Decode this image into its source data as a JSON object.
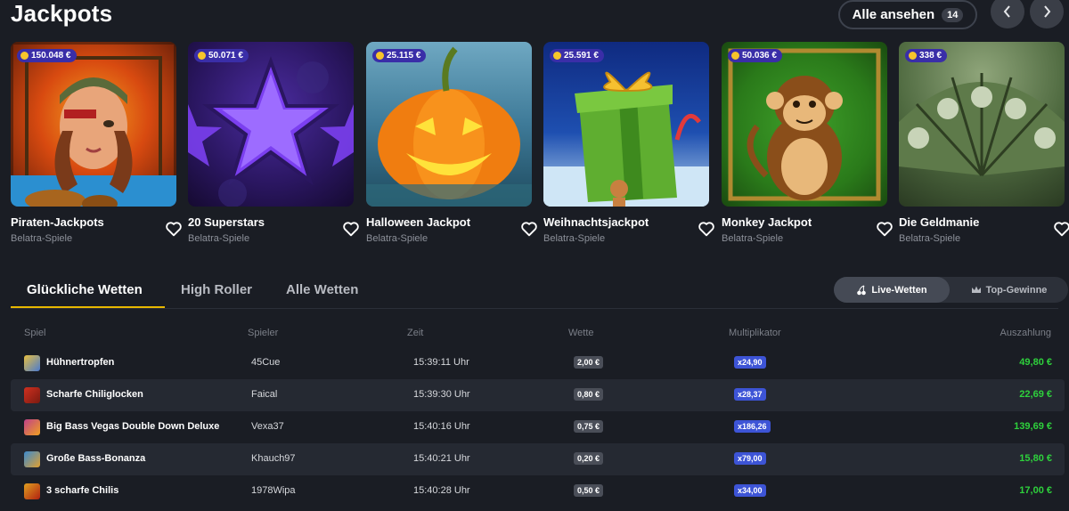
{
  "header": {
    "title": "Jackpots",
    "see_all": "Alle ansehen",
    "see_all_count": "14",
    "prev_icon": "chevron-left-icon",
    "next_icon": "chevron-right-icon"
  },
  "games": [
    {
      "name": "Piraten-Jackpots",
      "provider": "Belatra-Spiele",
      "jackpot": "150.048 €"
    },
    {
      "name": "20 Superstars",
      "provider": "Belatra-Spiele",
      "jackpot": "50.071 €"
    },
    {
      "name": "Halloween Jackpot",
      "provider": "Belatra-Spiele",
      "jackpot": "25.115 €"
    },
    {
      "name": "Weihnachtsjackpot",
      "provider": "Belatra-Spiele",
      "jackpot": "25.591 €"
    },
    {
      "name": "Monkey Jackpot",
      "provider": "Belatra-Spiele",
      "jackpot": "50.036 €"
    },
    {
      "name": "Die Geldmanie",
      "provider": "Belatra-Spiele",
      "jackpot": "338 €"
    }
  ],
  "bets_tabs": {
    "lucky": "Glückliche Wetten",
    "high_roller": "High Roller",
    "all": "Alle Wetten"
  },
  "toggle": {
    "live": "Live-Wetten",
    "top": "Top-Gewinne"
  },
  "table": {
    "headers": {
      "game": "Spiel",
      "player": "Spieler",
      "time": "Zeit",
      "bet": "Wette",
      "multiplier": "Multiplikator",
      "payout": "Auszahlung"
    },
    "rows": [
      {
        "game": "Hühnertropfen",
        "player": "45Cue",
        "time": "15:39:11 Uhr",
        "bet": "2,00 €",
        "multiplier": "x24,90",
        "payout": "49,80 €"
      },
      {
        "game": "Scharfe Chiliglocken",
        "player": "Faical",
        "time": "15:39:30 Uhr",
        "bet": "0,80 €",
        "multiplier": "x28,37",
        "payout": "22,69 €"
      },
      {
        "game": "Big Bass Vegas Double Down Deluxe",
        "player": "Vexa37",
        "time": "15:40:16 Uhr",
        "bet": "0,75 €",
        "multiplier": "x186,26",
        "payout": "139,69 €"
      },
      {
        "game": "Große Bass-Bonanza",
        "player": "Khauch97",
        "time": "15:40:21 Uhr",
        "bet": "0,20 €",
        "multiplier": "x79,00",
        "payout": "15,80 €"
      },
      {
        "game": "3 scharfe Chilis",
        "player": "1978Wipa",
        "time": "15:40:28 Uhr",
        "bet": "0,50 €",
        "multiplier": "x34,00",
        "payout": "17,00 €"
      }
    ]
  },
  "colors": {
    "accent": "#e8b800",
    "payout": "#2ed13c",
    "multiplier": "#3d54d6",
    "jackpot_badge": "#3a2ea8"
  }
}
